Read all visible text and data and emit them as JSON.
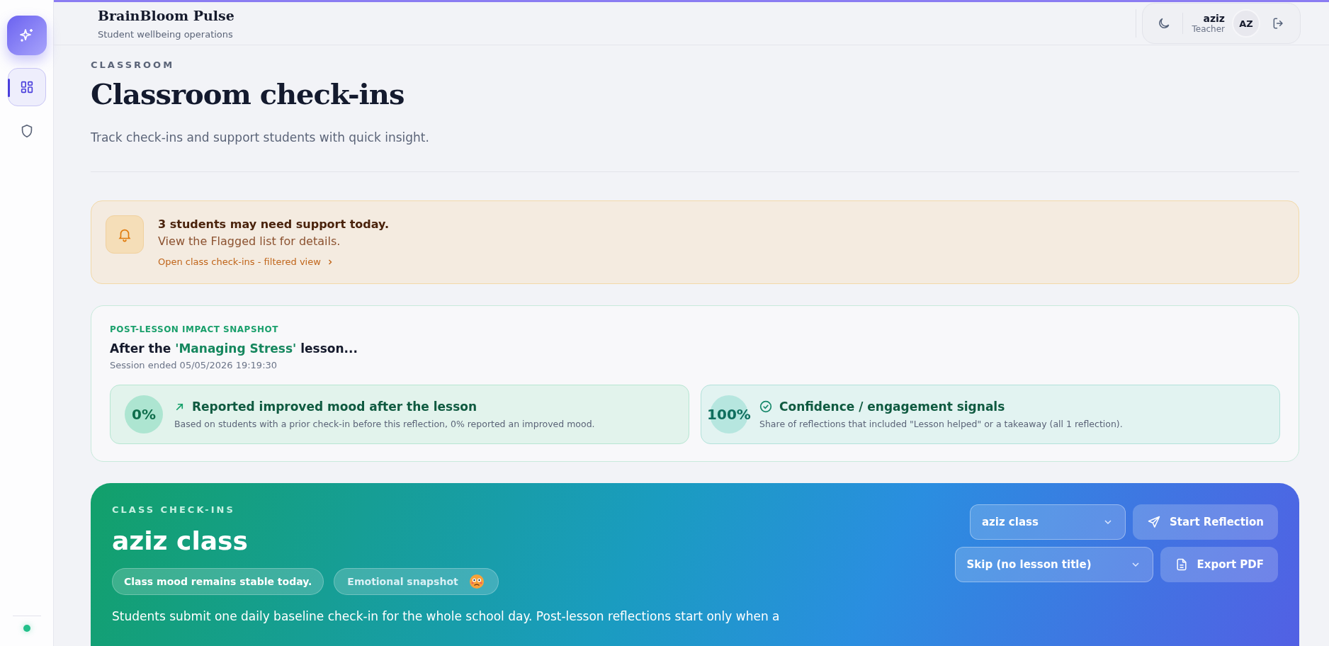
{
  "sidebar": {
    "items": [
      {
        "selected": true
      },
      {
        "selected": false
      }
    ]
  },
  "header": {
    "brand": "BrainBloom Pulse",
    "tagline": "Student wellbeing operations",
    "user": {
      "name": "aziz",
      "role": "Teacher",
      "initials": "AZ"
    }
  },
  "page": {
    "eyebrow": "CLASSROOM",
    "title": "Classroom check-ins",
    "subtitle": "Track check-ins and support students with quick insight."
  },
  "alert": {
    "title": "3 students may need support today.",
    "body": "View the Flagged list for details.",
    "link": "Open class check-ins - filtered view"
  },
  "snapshot": {
    "eyebrow": "POST-LESSON IMPACT SNAPSHOT",
    "lesson_prefix": "After the ",
    "lesson_name": "'Managing Stress'",
    "lesson_suffix": " lesson...",
    "session": "Session ended 05/05/2026 19:19:30",
    "metrics": [
      {
        "kind": "trend",
        "value": "0%",
        "title": "Reported improved mood after the lesson",
        "description": "Based on students with a prior check-in before this reflection, 0% reported an improved mood."
      },
      {
        "kind": "check",
        "value": "100%",
        "title": "Confidence / engagement signals",
        "description": "Share of reflections that included \"Lesson helped\" or a takeaway (all 1 reflection)."
      }
    ]
  },
  "class_panel": {
    "eyebrow": "CLASS CHECK-INS",
    "title": "aziz class",
    "chips": [
      "Class mood remains stable today.",
      "Emotional snapshot"
    ],
    "class_select": "aziz class",
    "lesson_select": "Skip (no lesson title)",
    "buttons": [
      {
        "kind": "send",
        "label": "Start Reflection"
      },
      {
        "kind": "pdf",
        "label": "Export PDF"
      }
    ],
    "note": "Students submit one daily baseline check-in for the whole school day. Post-lesson reflections start only when a"
  }
}
